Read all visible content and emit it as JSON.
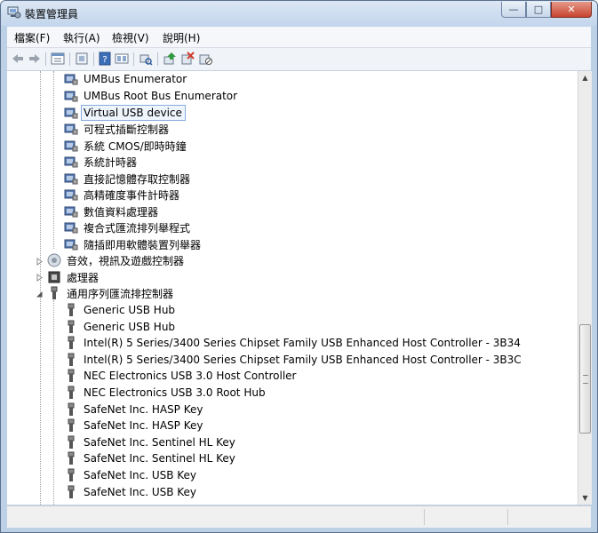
{
  "window": {
    "title": "裝置管理員",
    "min_glyph": "—",
    "max_glyph": "□",
    "close_glyph": "✕"
  },
  "menu": [
    {
      "label": "檔案(F)"
    },
    {
      "label": "執行(A)"
    },
    {
      "label": "檢視(V)"
    },
    {
      "label": "說明(H)"
    }
  ],
  "toolbar_icons": [
    "back-arrow-icon",
    "forward-arrow-icon",
    "properties-list-icon",
    "device-view-icon",
    "help-icon",
    "resources-view-icon",
    "scan-hardware-icon",
    "update-driver-icon",
    "uninstall-icon",
    "disable-icon"
  ],
  "tree": {
    "system_devices": [
      "UMBus Enumerator",
      "UMBus Root Bus Enumerator",
      "Virtual USB device",
      "可程式插斷控制器",
      "系統 CMOS/即時時鐘",
      "系統計時器",
      "直接記憶體存取控制器",
      "高精確度事件計時器",
      "數值資料處理器",
      "複合式匯流排列舉程式",
      "隨插即用軟體裝置列舉器"
    ],
    "categories": {
      "sound": "音效，視訊及遊戲控制器",
      "processor": "處理器",
      "usb": "通用序列匯流排控制器"
    },
    "usb_devices": [
      "Generic USB Hub",
      "Generic USB Hub",
      "Intel(R) 5 Series/3400 Series Chipset Family USB Enhanced Host Controller - 3B34",
      "Intel(R) 5 Series/3400 Series Chipset Family USB Enhanced Host Controller - 3B3C",
      "NEC Electronics USB 3.0 Host Controller",
      "NEC Electronics USB 3.0 Root Hub",
      "SafeNet Inc. HASP Key",
      "SafeNet Inc. HASP Key",
      "SafeNet Inc. Sentinel HL Key",
      "SafeNet Inc. Sentinel HL Key",
      "SafeNet Inc. USB Key",
      "SafeNet Inc. USB Key"
    ]
  },
  "colors": {
    "selection_border": "#84acdd",
    "selection_fill": "#eef5fd",
    "title_bar": "#c3d6ec"
  }
}
